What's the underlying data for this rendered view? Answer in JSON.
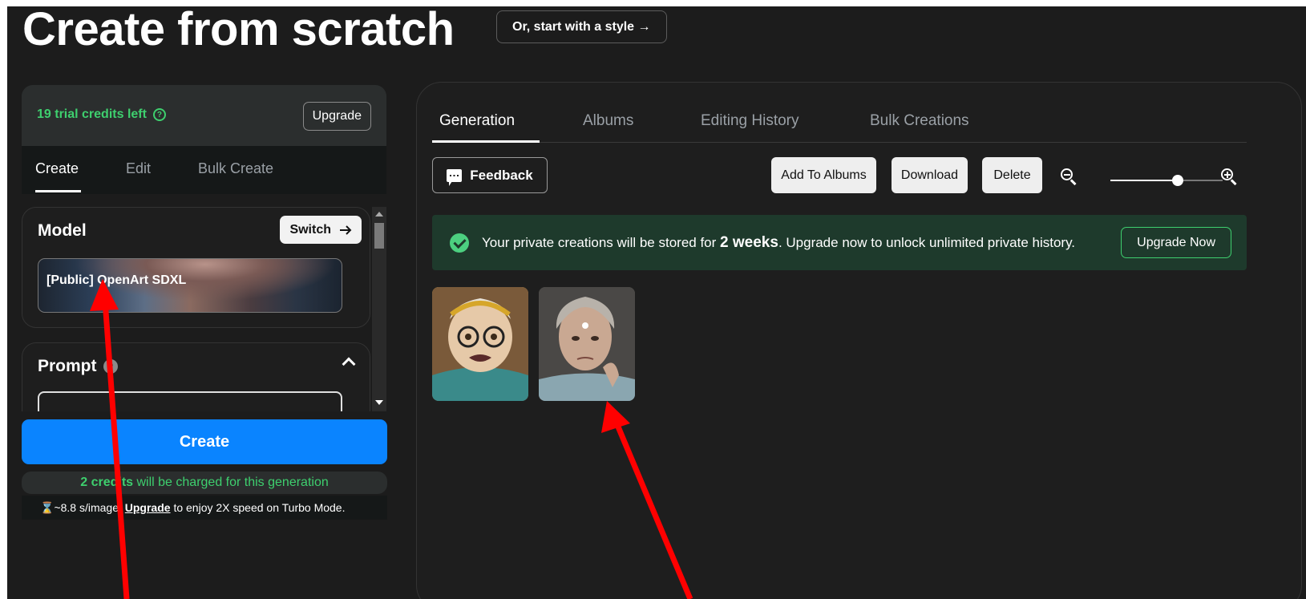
{
  "header": {
    "title": "Create from scratch",
    "style_button": "Or, start with a style →"
  },
  "left": {
    "credits_text": "19 trial credits left",
    "upgrade_label": "Upgrade",
    "tabs": [
      "Create",
      "Edit",
      "Bulk Create"
    ],
    "model": {
      "title": "Model",
      "switch_label": "Switch",
      "selected": "[Public] OpenArt SDXL"
    },
    "prompt": {
      "title": "Prompt"
    },
    "create_label": "Create",
    "charge": {
      "bold": "2 credits",
      "rest": " will be charged for this generation"
    },
    "speed": {
      "prefix": "~8.8 s/image. ",
      "link": "Upgrade",
      "suffix": " to enjoy 2X speed on Turbo Mode."
    }
  },
  "right": {
    "tabs": [
      "Generation",
      "Albums",
      "Editing History",
      "Bulk Creations"
    ],
    "feedback_label": "Feedback",
    "add_to_albums_label": "Add To Albums",
    "download_label": "Download",
    "delete_label": "Delete",
    "zoom_level": 0.6,
    "notice": {
      "prefix": "Your private creations will be stored for ",
      "bold": "2 weeks",
      "suffix": ". Upgrade now to unlock unlimited private history.",
      "button": "Upgrade Now"
    }
  },
  "colors": {
    "accent_blue": "#0a84ff",
    "credit_green": "#3ecf6e",
    "annotation_red": "#ff0000"
  }
}
